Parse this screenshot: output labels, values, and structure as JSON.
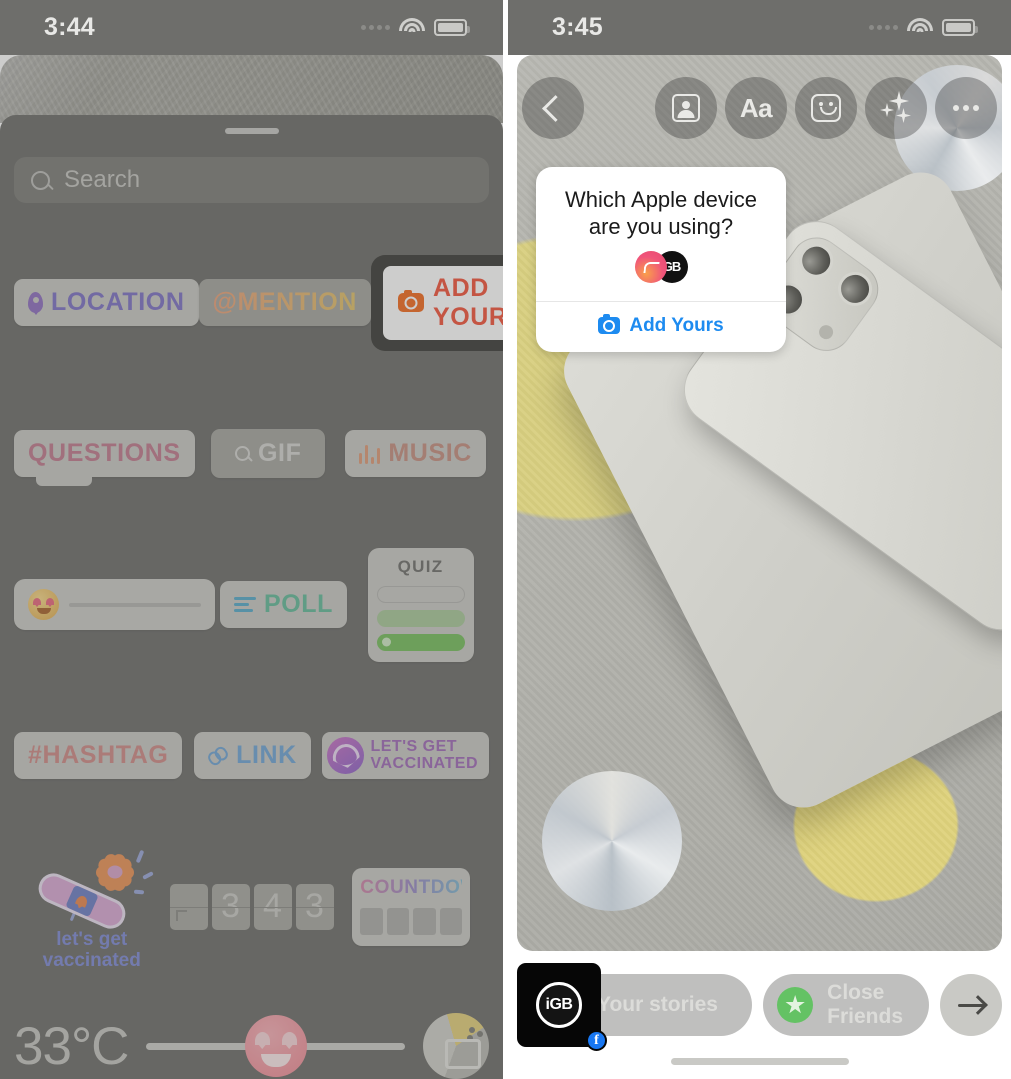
{
  "left_panel": {
    "status_bar": {
      "time": "3:44",
      "wifi_icon": "wifi-icon",
      "battery_icon": "battery-icon",
      "signal_icon": "signal-dots-icon"
    },
    "sheet": {
      "grabber": "drag-handle"
    },
    "search": {
      "placeholder": "Search",
      "icon": "search-icon"
    },
    "stickers": [
      {
        "name": "location",
        "label": "LOCATION",
        "icon": "map-pin-icon",
        "color": "#7d72c4"
      },
      {
        "name": "mention",
        "label": "@MENTION",
        "icon": "at-sign-icon",
        "color": "#e0a86f"
      },
      {
        "name": "add-yours",
        "label": "ADD YOURS",
        "icon": "camera-icon",
        "color": "#f2533c",
        "selected": true,
        "highlight_color": "#3b3b38"
      },
      {
        "name": "questions",
        "label": "QUESTIONS",
        "color": "#c07a8e"
      },
      {
        "name": "gif",
        "label": "GIF",
        "icon": "search-icon",
        "color": "#d3d3d0"
      },
      {
        "name": "music",
        "label": "MUSIC",
        "icon": "waveform-icon",
        "color": "#c58e80"
      },
      {
        "name": "emoji-slider",
        "label": "",
        "icon": "heart-eyes-emoji-icon"
      },
      {
        "name": "poll",
        "label": "POLL",
        "icon": "poll-bars-icon",
        "color": "#63b99a"
      },
      {
        "name": "quiz",
        "label": "QUIZ",
        "color": "#6f6f6c"
      },
      {
        "name": "hashtag",
        "label": "#HASHTAG",
        "color": "#cf8a87"
      },
      {
        "name": "link",
        "label": "LINK",
        "icon": "link-chain-icon",
        "color": "#6fa4d4"
      },
      {
        "name": "lets-get-vaccinated-pill",
        "label": "LET'S GET\nVACCINATED",
        "color": "#a06bb8"
      },
      {
        "name": "vaccinated-art",
        "label": "let's get\nvaccinated",
        "color": "#7e8ad4"
      },
      {
        "name": "flip-clock",
        "digits": [
          "",
          "3",
          "4",
          "3"
        ]
      },
      {
        "name": "countdown",
        "label": "COUNTDOWN"
      }
    ],
    "vax_pill": {
      "line1": "LET'S GET",
      "line2": "VACCINATED"
    },
    "vax_art": {
      "line1": "let's get",
      "line2": "vaccinated"
    },
    "quiz": {
      "title": "QUIZ"
    },
    "countdown": {
      "title": "COUNTDOWN"
    },
    "flip_clock": {
      "d1": "",
      "d2": "3",
      "d3": "4",
      "d4": "3"
    },
    "partial_row": {
      "temperature": "33°C",
      "emoji": "heart-eyes-emoji-icon",
      "photo_sticker": "photo-sticker-icon"
    }
  },
  "right_panel": {
    "status_bar": {
      "time": "3:45",
      "wifi_icon": "wifi-icon",
      "battery_icon": "battery-icon",
      "signal_icon": "signal-dots-icon"
    },
    "toolbar": {
      "back_icon": "back-chevron-icon",
      "actions": [
        {
          "name": "your-story-card",
          "icon": "person-card-icon"
        },
        {
          "name": "text",
          "icon": "text-aa-icon",
          "label": "Aa"
        },
        {
          "name": "stickers",
          "icon": "sticker-smiley-icon"
        },
        {
          "name": "effects",
          "icon": "sparkles-icon"
        },
        {
          "name": "more",
          "icon": "more-dots-icon"
        }
      ]
    },
    "add_yours_card": {
      "question": "Which Apple device are you using?",
      "avatar_secondary_label": "GB",
      "cta_label": "Add Yours",
      "cta_icon": "camera-icon",
      "cta_color": "#1d8bf0"
    },
    "bottom_bar": {
      "your_stories_label": "Your stories",
      "close_friends_label": "Close Friends",
      "close_friends_icon": "green-star-icon",
      "send_icon": "arrow-right-icon",
      "avatar": {
        "name": "iGB",
        "badge": "facebook-badge-icon",
        "badge_glyph": "f"
      }
    },
    "home_indicator": "home-indicator"
  }
}
